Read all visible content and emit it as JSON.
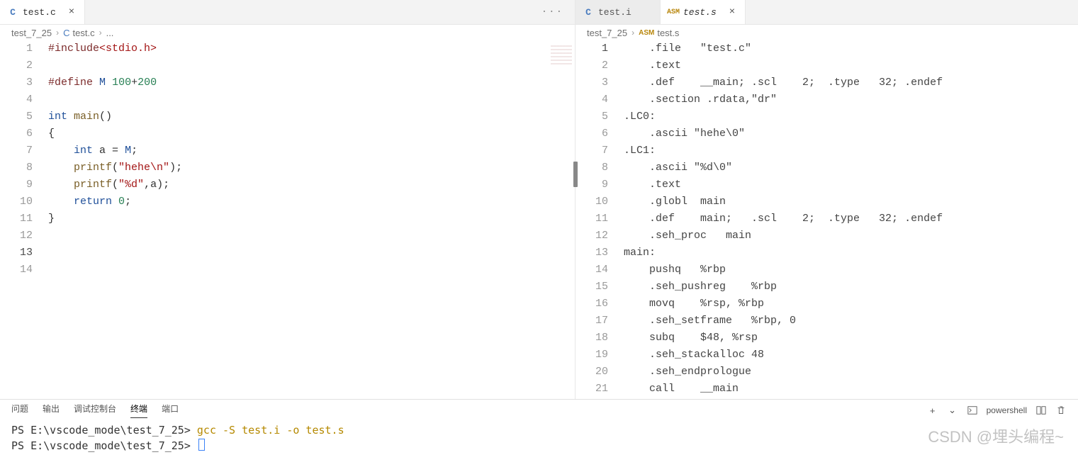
{
  "left": {
    "tabs": [
      {
        "icon": "C",
        "iconClass": "c",
        "label": "test.c",
        "active": true,
        "closable": true
      }
    ],
    "more": "···",
    "breadcrumb": {
      "root": "test_7_25",
      "fileIcon": "C",
      "file": "test.c",
      "tail": "..."
    },
    "lines": [
      "1",
      "2",
      "3",
      "4",
      "5",
      "6",
      "7",
      "8",
      "9",
      "10",
      "11",
      "12",
      "13",
      "14"
    ],
    "code": {
      "l1": {
        "a": "#include",
        "b": "<stdio.h>"
      },
      "l3": {
        "a": "#define",
        "b": "M",
        "c": "100",
        "d": "+",
        "e": "200"
      },
      "l5": {
        "a": "int",
        "b": "main",
        "c": "()"
      },
      "l6": "{",
      "l7": {
        "a": "int",
        "b": " a ",
        "c": "=",
        "d": " ",
        "e": "M",
        "f": ";"
      },
      "l8": {
        "a": "printf",
        "b": "(",
        "c": "\"hehe\\n\"",
        "d": ");"
      },
      "l9": {
        "a": "printf",
        "b": "(",
        "c": "\"%d\"",
        "d": ",a);"
      },
      "l10": {
        "a": "return",
        "b": " ",
        "c": "0",
        "d": ";"
      },
      "l11": "}"
    }
  },
  "right": {
    "tabs": [
      {
        "icon": "C",
        "iconClass": "c",
        "label": "test.i",
        "active": false,
        "closable": false
      },
      {
        "icon": "ASM",
        "iconClass": "asm",
        "label": "test.s",
        "italic": true,
        "active": true,
        "closable": true
      }
    ],
    "breadcrumb": {
      "root": "test_7_25",
      "fileIcon": "ASM",
      "file": "test.s"
    },
    "lines": [
      "1",
      "2",
      "3",
      "4",
      "5",
      "6",
      "7",
      "8",
      "9",
      "10",
      "11",
      "12",
      "13",
      "14",
      "15",
      "16",
      "17",
      "18",
      "19",
      "20",
      "21"
    ],
    "code": {
      "l1": "    .file   \"test.c\"",
      "l2": "    .text",
      "l3": "    .def    __main; .scl    2;  .type   32; .endef",
      "l4": "    .section .rdata,\"dr\"",
      "l5": ".LC0:",
      "l6": "    .ascii \"hehe\\0\"",
      "l7": ".LC1:",
      "l8": "    .ascii \"%d\\0\"",
      "l9": "    .text",
      "l10": "    .globl  main",
      "l11": "    .def    main;   .scl    2;  .type   32; .endef",
      "l12": "    .seh_proc   main",
      "l13": "main:",
      "l14": "    pushq   %rbp",
      "l15": "    .seh_pushreg    %rbp",
      "l16": "    movq    %rsp, %rbp",
      "l17": "    .seh_setframe   %rbp, 0",
      "l18": "    subq    $48, %rsp",
      "l19": "    .seh_stackalloc 48",
      "l20": "    .seh_endprologue",
      "l21": "    call    __main"
    }
  },
  "panel": {
    "tabs": {
      "problems": "问题",
      "output": "输出",
      "debug": "调试控制台",
      "terminal": "终端",
      "ports": "端口"
    },
    "activeTab": "terminal",
    "shell": "powershell",
    "icons": {
      "plus": "+",
      "chev": "⌄",
      "split": "▯▯",
      "trash": "🗑"
    },
    "terminal": {
      "prompt1": "PS E:\\vscode_mode\\test_7_25>",
      "cmd1": "gcc -S test.i -o test.s",
      "prompt2": "PS E:\\vscode_mode\\test_7_25>"
    }
  },
  "watermark": "CSDN @埋头编程~"
}
